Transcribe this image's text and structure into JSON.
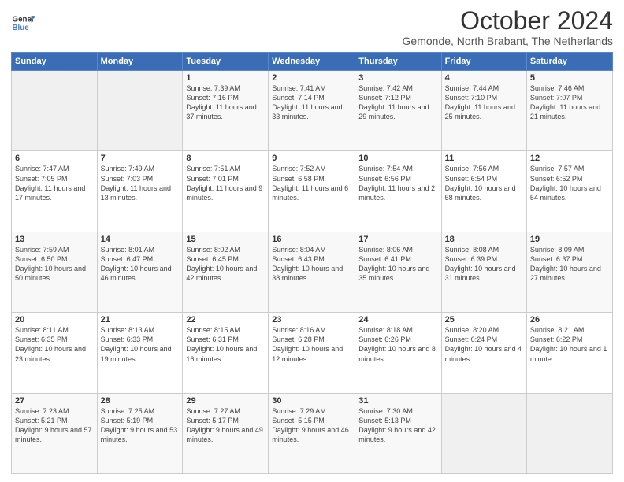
{
  "header": {
    "logo_line1": "General",
    "logo_line2": "Blue",
    "month": "October 2024",
    "location": "Gemonde, North Brabant, The Netherlands"
  },
  "days_of_week": [
    "Sunday",
    "Monday",
    "Tuesday",
    "Wednesday",
    "Thursday",
    "Friday",
    "Saturday"
  ],
  "weeks": [
    [
      {
        "day": "",
        "sunrise": "",
        "sunset": "",
        "daylight": ""
      },
      {
        "day": "",
        "sunrise": "",
        "sunset": "",
        "daylight": ""
      },
      {
        "day": "1",
        "sunrise": "Sunrise: 7:39 AM",
        "sunset": "Sunset: 7:16 PM",
        "daylight": "Daylight: 11 hours and 37 minutes."
      },
      {
        "day": "2",
        "sunrise": "Sunrise: 7:41 AM",
        "sunset": "Sunset: 7:14 PM",
        "daylight": "Daylight: 11 hours and 33 minutes."
      },
      {
        "day": "3",
        "sunrise": "Sunrise: 7:42 AM",
        "sunset": "Sunset: 7:12 PM",
        "daylight": "Daylight: 11 hours and 29 minutes."
      },
      {
        "day": "4",
        "sunrise": "Sunrise: 7:44 AM",
        "sunset": "Sunset: 7:10 PM",
        "daylight": "Daylight: 11 hours and 25 minutes."
      },
      {
        "day": "5",
        "sunrise": "Sunrise: 7:46 AM",
        "sunset": "Sunset: 7:07 PM",
        "daylight": "Daylight: 11 hours and 21 minutes."
      }
    ],
    [
      {
        "day": "6",
        "sunrise": "Sunrise: 7:47 AM",
        "sunset": "Sunset: 7:05 PM",
        "daylight": "Daylight: 11 hours and 17 minutes."
      },
      {
        "day": "7",
        "sunrise": "Sunrise: 7:49 AM",
        "sunset": "Sunset: 7:03 PM",
        "daylight": "Daylight: 11 hours and 13 minutes."
      },
      {
        "day": "8",
        "sunrise": "Sunrise: 7:51 AM",
        "sunset": "Sunset: 7:01 PM",
        "daylight": "Daylight: 11 hours and 9 minutes."
      },
      {
        "day": "9",
        "sunrise": "Sunrise: 7:52 AM",
        "sunset": "Sunset: 6:58 PM",
        "daylight": "Daylight: 11 hours and 6 minutes."
      },
      {
        "day": "10",
        "sunrise": "Sunrise: 7:54 AM",
        "sunset": "Sunset: 6:56 PM",
        "daylight": "Daylight: 11 hours and 2 minutes."
      },
      {
        "day": "11",
        "sunrise": "Sunrise: 7:56 AM",
        "sunset": "Sunset: 6:54 PM",
        "daylight": "Daylight: 10 hours and 58 minutes."
      },
      {
        "day": "12",
        "sunrise": "Sunrise: 7:57 AM",
        "sunset": "Sunset: 6:52 PM",
        "daylight": "Daylight: 10 hours and 54 minutes."
      }
    ],
    [
      {
        "day": "13",
        "sunrise": "Sunrise: 7:59 AM",
        "sunset": "Sunset: 6:50 PM",
        "daylight": "Daylight: 10 hours and 50 minutes."
      },
      {
        "day": "14",
        "sunrise": "Sunrise: 8:01 AM",
        "sunset": "Sunset: 6:47 PM",
        "daylight": "Daylight: 10 hours and 46 minutes."
      },
      {
        "day": "15",
        "sunrise": "Sunrise: 8:02 AM",
        "sunset": "Sunset: 6:45 PM",
        "daylight": "Daylight: 10 hours and 42 minutes."
      },
      {
        "day": "16",
        "sunrise": "Sunrise: 8:04 AM",
        "sunset": "Sunset: 6:43 PM",
        "daylight": "Daylight: 10 hours and 38 minutes."
      },
      {
        "day": "17",
        "sunrise": "Sunrise: 8:06 AM",
        "sunset": "Sunset: 6:41 PM",
        "daylight": "Daylight: 10 hours and 35 minutes."
      },
      {
        "day": "18",
        "sunrise": "Sunrise: 8:08 AM",
        "sunset": "Sunset: 6:39 PM",
        "daylight": "Daylight: 10 hours and 31 minutes."
      },
      {
        "day": "19",
        "sunrise": "Sunrise: 8:09 AM",
        "sunset": "Sunset: 6:37 PM",
        "daylight": "Daylight: 10 hours and 27 minutes."
      }
    ],
    [
      {
        "day": "20",
        "sunrise": "Sunrise: 8:11 AM",
        "sunset": "Sunset: 6:35 PM",
        "daylight": "Daylight: 10 hours and 23 minutes."
      },
      {
        "day": "21",
        "sunrise": "Sunrise: 8:13 AM",
        "sunset": "Sunset: 6:33 PM",
        "daylight": "Daylight: 10 hours and 19 minutes."
      },
      {
        "day": "22",
        "sunrise": "Sunrise: 8:15 AM",
        "sunset": "Sunset: 6:31 PM",
        "daylight": "Daylight: 10 hours and 16 minutes."
      },
      {
        "day": "23",
        "sunrise": "Sunrise: 8:16 AM",
        "sunset": "Sunset: 6:28 PM",
        "daylight": "Daylight: 10 hours and 12 minutes."
      },
      {
        "day": "24",
        "sunrise": "Sunrise: 8:18 AM",
        "sunset": "Sunset: 6:26 PM",
        "daylight": "Daylight: 10 hours and 8 minutes."
      },
      {
        "day": "25",
        "sunrise": "Sunrise: 8:20 AM",
        "sunset": "Sunset: 6:24 PM",
        "daylight": "Daylight: 10 hours and 4 minutes."
      },
      {
        "day": "26",
        "sunrise": "Sunrise: 8:21 AM",
        "sunset": "Sunset: 6:22 PM",
        "daylight": "Daylight: 10 hours and 1 minute."
      }
    ],
    [
      {
        "day": "27",
        "sunrise": "Sunrise: 7:23 AM",
        "sunset": "Sunset: 5:21 PM",
        "daylight": "Daylight: 9 hours and 57 minutes."
      },
      {
        "day": "28",
        "sunrise": "Sunrise: 7:25 AM",
        "sunset": "Sunset: 5:19 PM",
        "daylight": "Daylight: 9 hours and 53 minutes."
      },
      {
        "day": "29",
        "sunrise": "Sunrise: 7:27 AM",
        "sunset": "Sunset: 5:17 PM",
        "daylight": "Daylight: 9 hours and 49 minutes."
      },
      {
        "day": "30",
        "sunrise": "Sunrise: 7:29 AM",
        "sunset": "Sunset: 5:15 PM",
        "daylight": "Daylight: 9 hours and 46 minutes."
      },
      {
        "day": "31",
        "sunrise": "Sunrise: 7:30 AM",
        "sunset": "Sunset: 5:13 PM",
        "daylight": "Daylight: 9 hours and 42 minutes."
      },
      {
        "day": "",
        "sunrise": "",
        "sunset": "",
        "daylight": ""
      },
      {
        "day": "",
        "sunrise": "",
        "sunset": "",
        "daylight": ""
      }
    ]
  ]
}
